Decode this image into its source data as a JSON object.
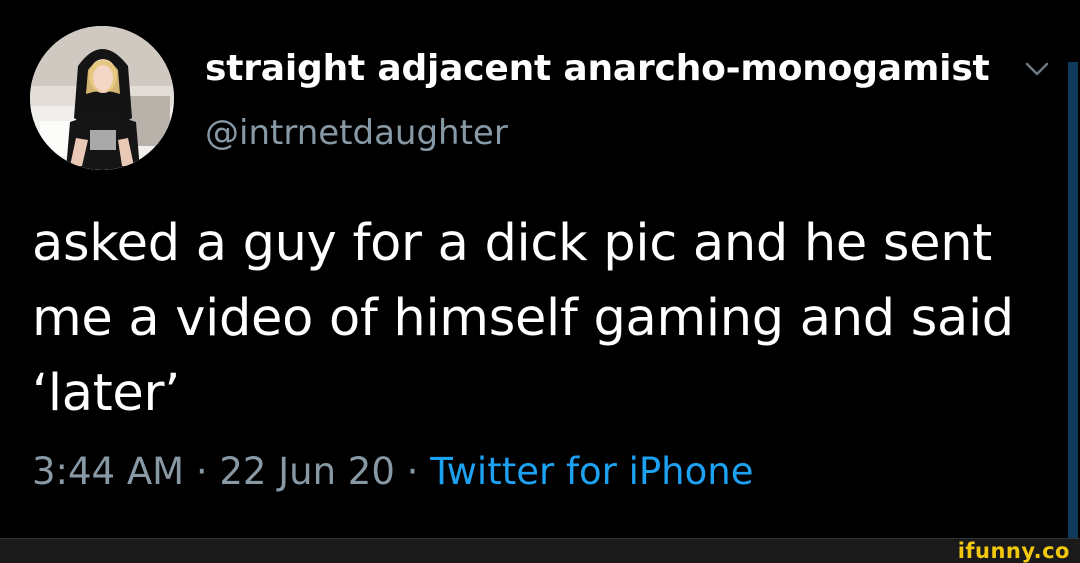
{
  "user": {
    "display_name": "straight adjacent anarcho-monogamist",
    "handle": "@intrnetdaughter",
    "avatar_icon": "profile-photo"
  },
  "tweet": {
    "text": "asked a guy for a dick pic and he sent me a video of himself gaming and said ‘later’",
    "time": "3:44 AM",
    "separator": "·",
    "date": "22 Jun 20",
    "source": "Twitter for iPhone"
  },
  "watermark": {
    "text": "ifunny.co"
  },
  "colors": {
    "background": "#000000",
    "primary_text": "#ffffff",
    "secondary_text": "#8899a6",
    "link": "#1da1f2",
    "watermark": "#f2c80f"
  }
}
